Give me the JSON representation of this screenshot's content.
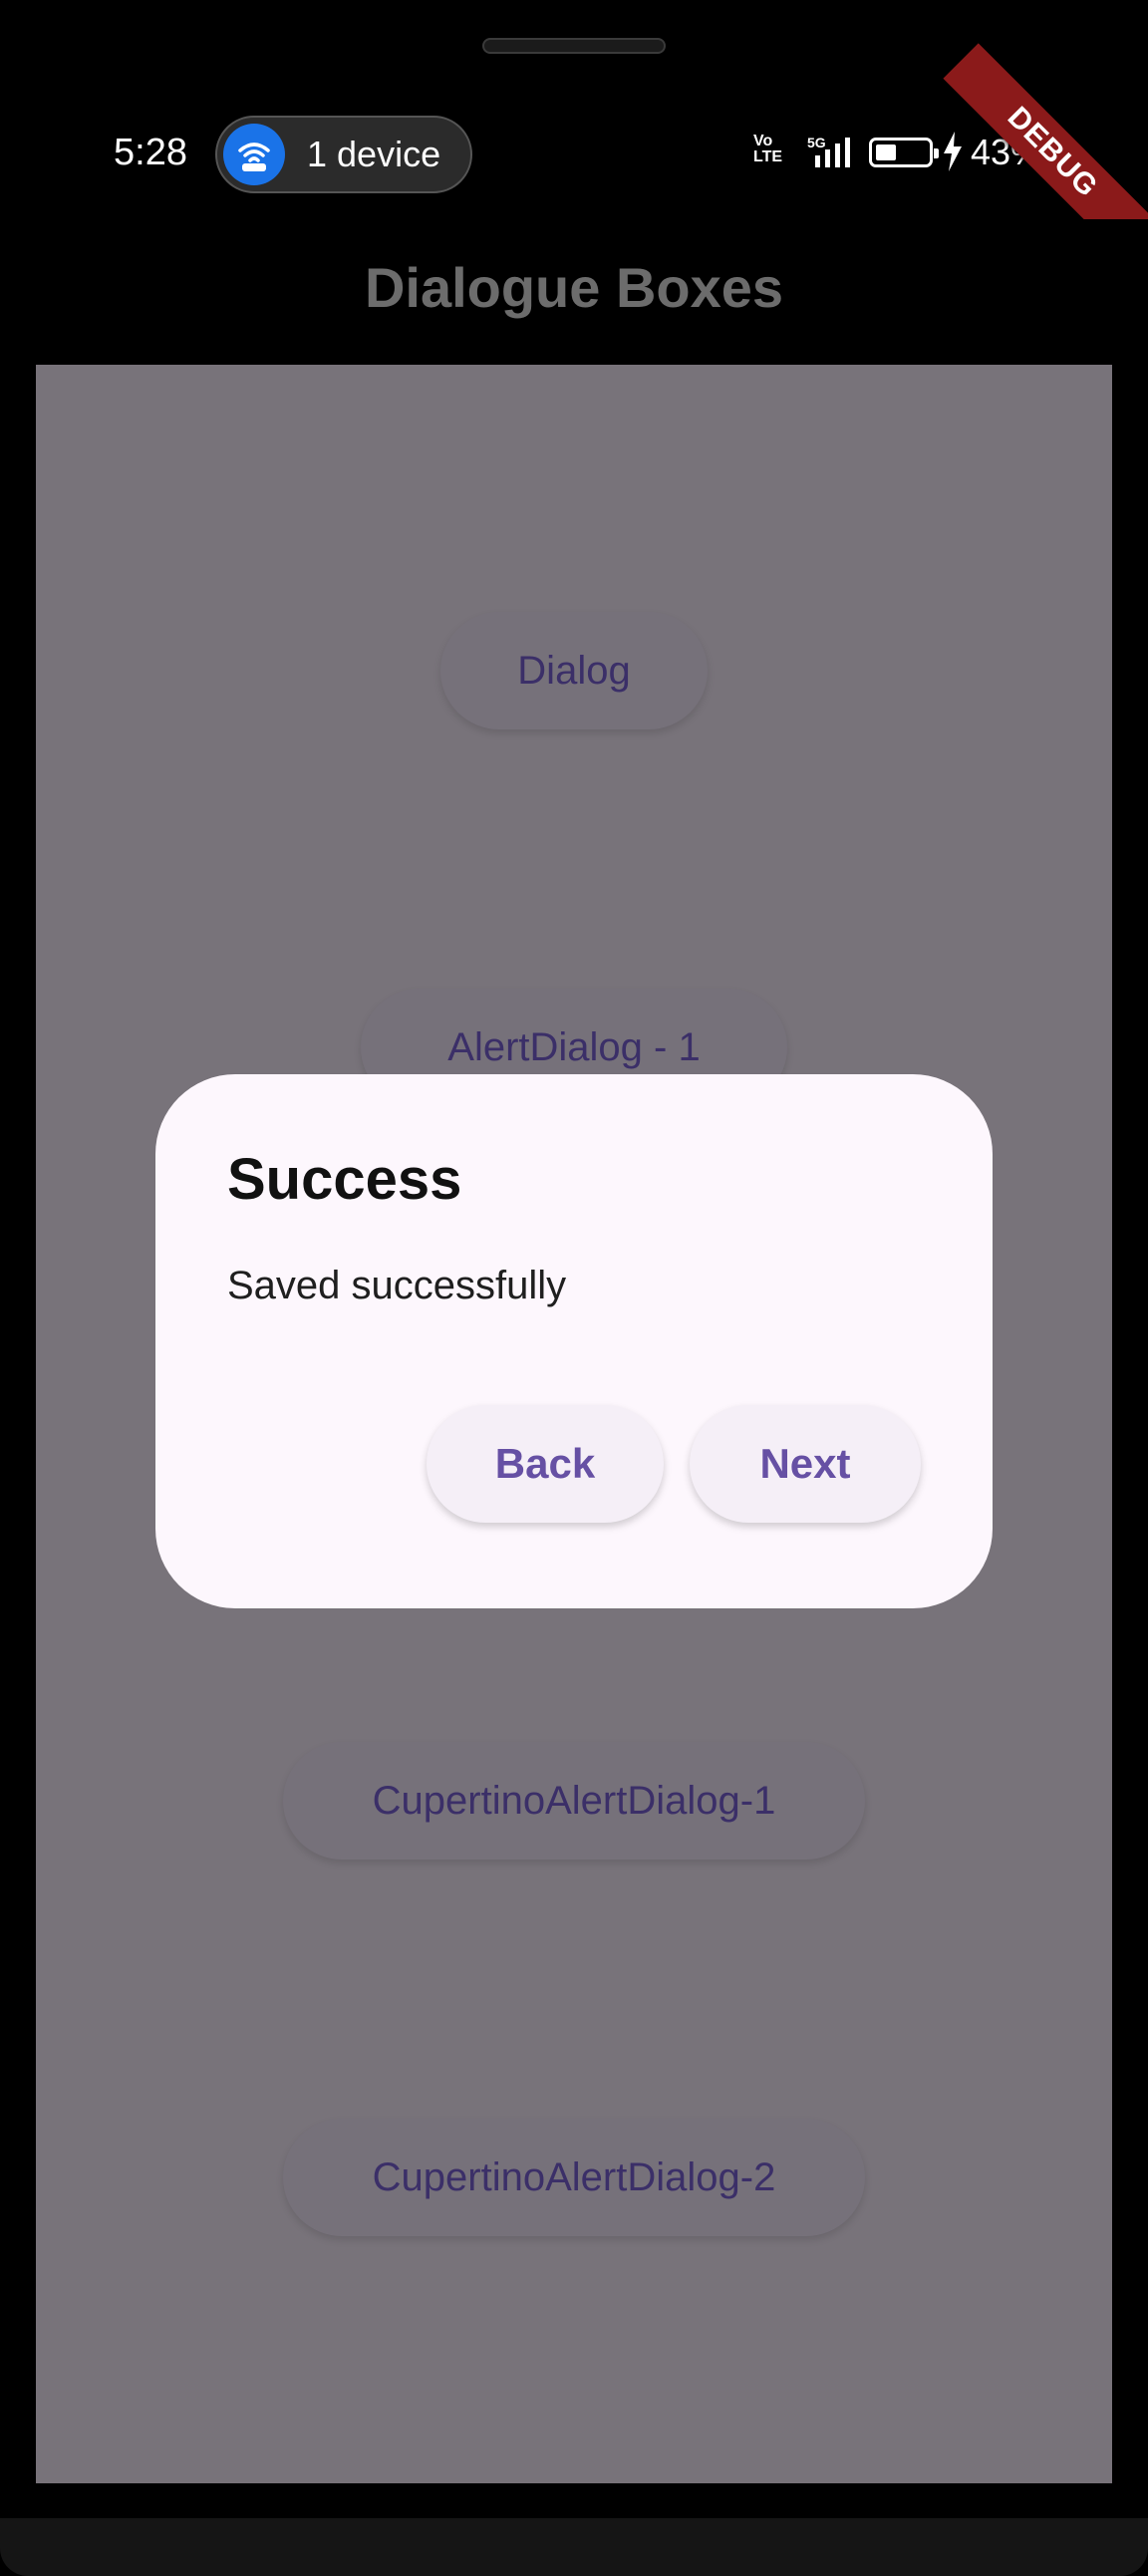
{
  "status_bar": {
    "time": "5:28",
    "device_pill": "1 device",
    "volte_line1": "Vo",
    "volte_line2": "LTE",
    "network": "5G",
    "battery": "43%"
  },
  "debug_banner": "DEBUG",
  "appbar": {
    "title": "Dialogue Boxes"
  },
  "buttons": {
    "dialog": "Dialog",
    "alert_dialog_1": "AlertDialog - 1",
    "cupertino_1": "CupertinoAlertDialog-1",
    "cupertino_2": "CupertinoAlertDialog-2"
  },
  "dialog": {
    "title": "Success",
    "message": "Saved successfully",
    "back_label": "Back",
    "next_label": "Next"
  },
  "colors": {
    "scrim": "#78737a",
    "dialog_bg": "#fdf7fd",
    "accent": "#6650a4",
    "debug": "#8b1a1a"
  }
}
